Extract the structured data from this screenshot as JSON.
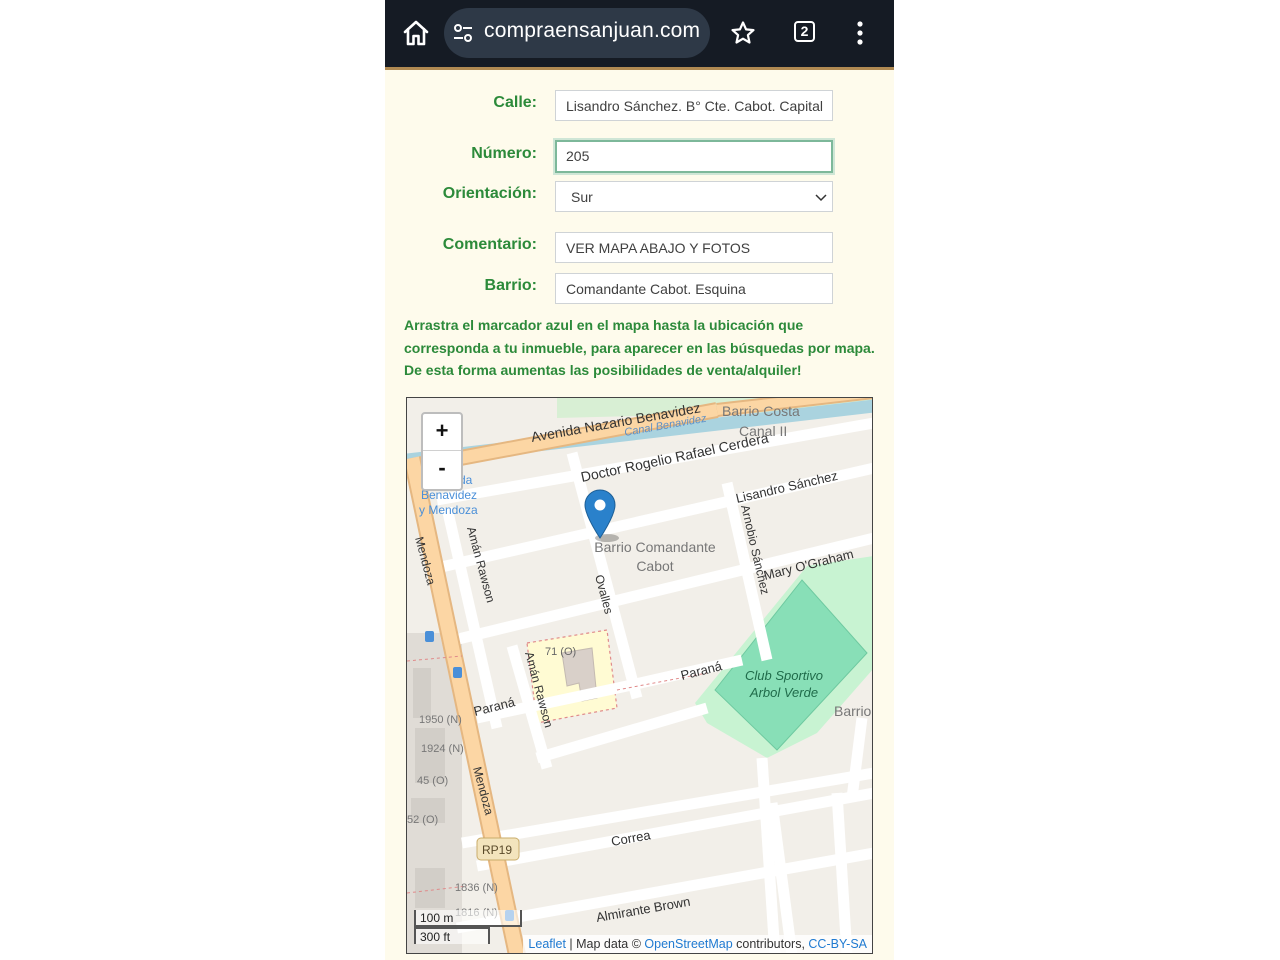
{
  "browser": {
    "url": "compraensanjuan.com",
    "tab_count": "2"
  },
  "form": {
    "calle_label": "Calle:",
    "calle_value": "Lisandro Sánchez. B° Cte. Cabot. Capital",
    "numero_label": "Número:",
    "numero_value": "205",
    "orientacion_label": "Orientación:",
    "orientacion_value": "Sur",
    "comentario_label": "Comentario:",
    "comentario_value": "VER MAPA ABAJO Y FOTOS",
    "barrio_label": "Barrio:",
    "barrio_value": "Comandante Cabot. Esquina"
  },
  "info_text": "Arrastra el marcador azul en el mapa hasta la ubicación que corresponda a tu inmueble, para aparecer en las búsquedas por mapa. De esta forma aumentas las posibilidades de venta/alquiler!",
  "map": {
    "zoom_in": "+",
    "zoom_out": "-",
    "scale_metric": "100 m",
    "scale_imperial": "300 ft",
    "attribution": {
      "leaflet": "Leaflet",
      "sep": " | Map data © ",
      "osm": "OpenStreetMap",
      "contrib": " contributors, ",
      "license": "CC-BY-SA"
    },
    "labels": {
      "avenida": "Avenida Nazario Benavidez",
      "canal": "Canal Benavidez",
      "barrio_costa": "Barrio Costa",
      "canal_ii": "Canal II",
      "cerdera": "Doctor Rogelio Rafael Cerdera",
      "lisandro": "Lisandro Sánchez",
      "arnobio": "Arnobio Sánchez",
      "barrio_cabot_1": "Barrio Comandante",
      "barrio_cabot_2": "Cabot",
      "mary": "Mary O'Graham",
      "aman_1": "Amán Rawson",
      "aman_2": "Amán Rawson",
      "ovalles": "Ovalles",
      "mendoza_1": "Mendoza",
      "mendoza_2": "Mendoza",
      "benavidez_1": "da",
      "benavidez_2": "Benavidez",
      "benavidez_3": "y Mendoza",
      "school": "71 (O)",
      "parana_1": "Paraná",
      "parana_2": "Paraná",
      "club_1": "Club Sportivo",
      "club_2": "Arbol Verde",
      "barrio_edge": "Barrio",
      "n1950": "1950 (N)",
      "n1924": "1924 (N)",
      "n45": "45 (O)",
      "n52": "52 (O)",
      "rp19": "RP19",
      "correa": "Correa",
      "n1836": "1836 (N)",
      "n1816": "1816 (N)",
      "brown": "Almirante Brown"
    },
    "colors": {
      "land": "#f2efe9",
      "road_white": "#ffffff",
      "road_primary": "#fcd6a4",
      "road_casing": "#e5b781",
      "park": "#c8f3d2",
      "pitch": "#88dfb7",
      "water": "#aad3df",
      "school": "#fffbd3",
      "marker": "#2a81cb"
    }
  }
}
